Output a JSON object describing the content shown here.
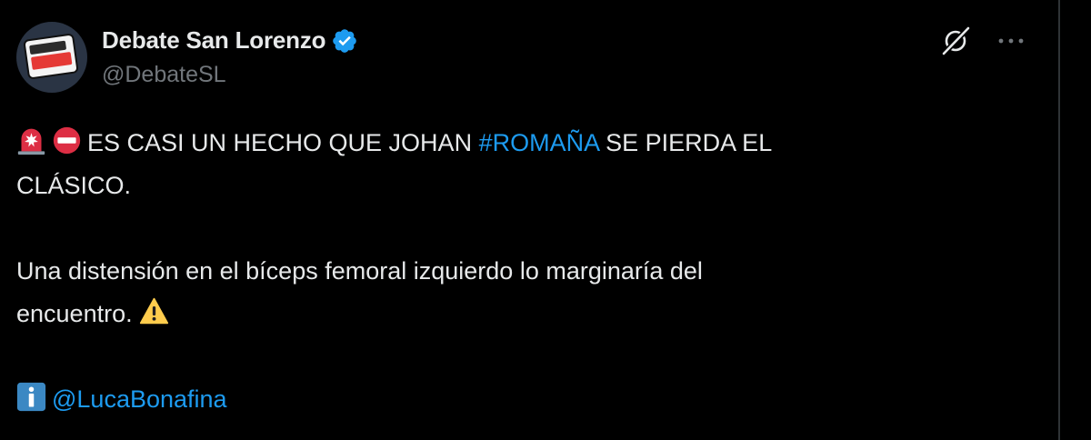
{
  "author": {
    "display_name": "Debate San Lorenzo",
    "handle": "@DebateSL",
    "verified": true
  },
  "icons": {
    "grok": "grok-icon",
    "more": "more-horizontal-icon",
    "verified": "verified-badge-icon",
    "siren": "police-siren-icon",
    "no_entry": "no-entry-icon",
    "warning": "warning-icon",
    "info": "information-icon"
  },
  "tweet": {
    "line1_pre": "ES CASI UN HECHO QUE JOHAN ",
    "hashtag": "#ROMAÑA",
    "line1_post": " SE PIERDA EL",
    "line2": "CLÁSICO.",
    "para2_line1": "Una distensión en el bíceps femoral izquierdo lo marginaría del",
    "para2_line2": "encuentro.",
    "mention": "@LucaBonafina"
  },
  "colors": {
    "background": "#000000",
    "text": "#e7e9ea",
    "secondary": "#71767b",
    "link": "#1d9bf0"
  }
}
